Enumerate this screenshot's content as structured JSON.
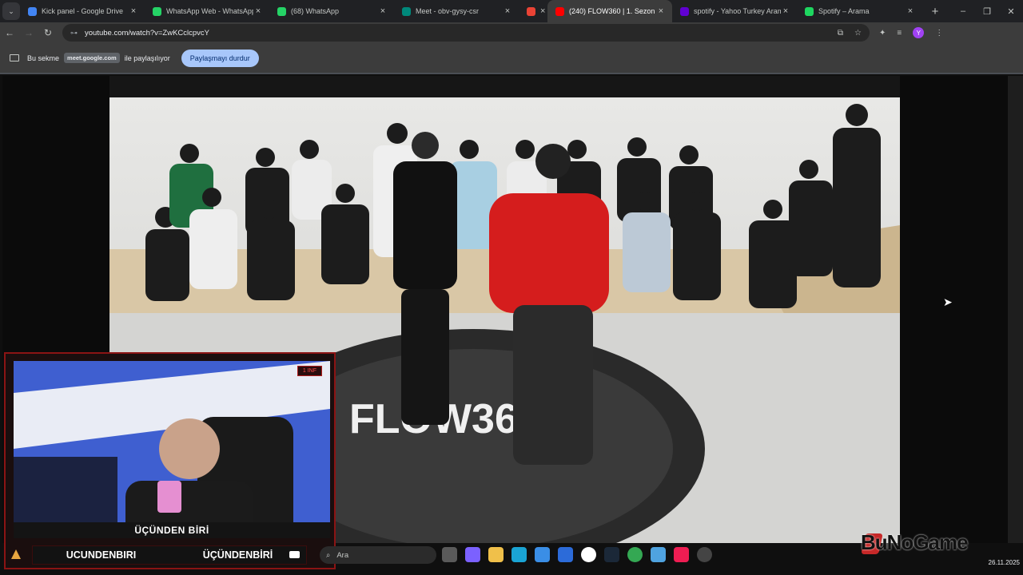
{
  "browser": {
    "tabs": [
      {
        "title": "Kick panel - Google Drive",
        "favicon_color": "#4285f4"
      },
      {
        "title": "WhatsApp Web - WhatsApp Bi",
        "favicon_color": "#25d366"
      },
      {
        "title": "(68) WhatsApp",
        "favicon_color": "#25d366"
      },
      {
        "title": "Meet - obv-gysy-csr",
        "favicon_color": "#00897b"
      },
      {
        "title": "",
        "favicon_color": "#ea4335"
      },
      {
        "title": "(240) FLOW360 | 1. Sezon",
        "favicon_color": "#ff0000",
        "active": true
      },
      {
        "title": "spotify - Yahoo Turkey Arama",
        "favicon_color": "#6001d2"
      },
      {
        "title": "Spotify – Arama",
        "favicon_color": "#1ed760"
      }
    ],
    "new_tab_label": "+",
    "window_controls": [
      "–",
      "❐",
      "✕"
    ],
    "url": "youtube.com/watch?v=ZwKCclcpvcY",
    "profile_initial": "Y"
  },
  "share_bar": {
    "prefix": "Bu sekme",
    "domain": "meet.google.com",
    "suffix": "ile paylaşılıyor",
    "stop_label": "Paylaşmayı durdur"
  },
  "video": {
    "floor_logo": "FLOW360"
  },
  "webcam": {
    "name": "ÜÇÜNDEN BİRİ",
    "badge": "1 INF"
  },
  "social_bar": {
    "instagram": "UCUNDENBIRI",
    "youtube": "ÜÇÜNDENBİRİ"
  },
  "taskbar": {
    "search_placeholder": "Ara",
    "date": "26.11.2025"
  },
  "watermark": {
    "text": "BuNoGame"
  },
  "colors": {
    "accent_red": "#8b1414",
    "stop_button": "#a8c7fa",
    "tab_active": "#3c3c3c"
  }
}
